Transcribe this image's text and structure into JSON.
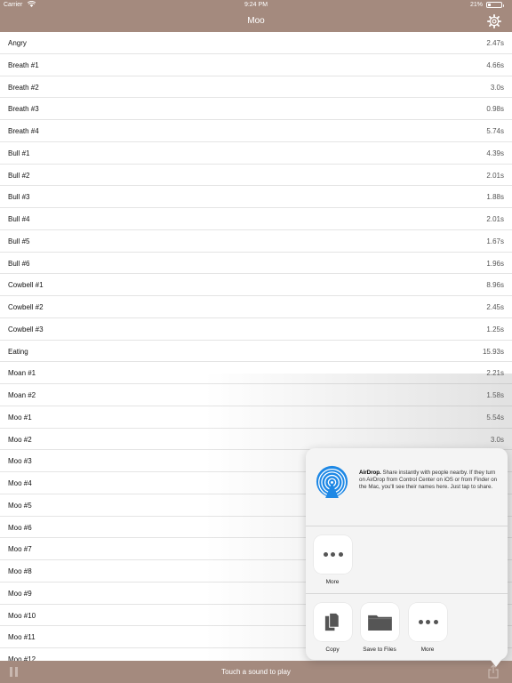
{
  "status_bar": {
    "carrier": "Carrier",
    "time": "9:24 PM",
    "battery": "21%"
  },
  "nav": {
    "title": "Moo",
    "settings_icon": "gear-icon"
  },
  "sounds": [
    {
      "name": "Angry",
      "duration": "2.47s"
    },
    {
      "name": "Breath #1",
      "duration": "4.66s"
    },
    {
      "name": "Breath #2",
      "duration": "3.0s"
    },
    {
      "name": "Breath #3",
      "duration": "0.98s"
    },
    {
      "name": "Breath #4",
      "duration": "5.74s"
    },
    {
      "name": "Bull #1",
      "duration": "4.39s"
    },
    {
      "name": "Bull #2",
      "duration": "2.01s"
    },
    {
      "name": "Bull #3",
      "duration": "1.88s"
    },
    {
      "name": "Bull #4",
      "duration": "2.01s"
    },
    {
      "name": "Bull #5",
      "duration": "1.67s"
    },
    {
      "name": "Bull #6",
      "duration": "1.96s"
    },
    {
      "name": "Cowbell #1",
      "duration": "8.96s"
    },
    {
      "name": "Cowbell #2",
      "duration": "2.45s"
    },
    {
      "name": "Cowbell #3",
      "duration": "1.25s"
    },
    {
      "name": "Eating",
      "duration": "15.93s"
    },
    {
      "name": "Moan #1",
      "duration": "2.21s"
    },
    {
      "name": "Moan #2",
      "duration": "1.58s"
    },
    {
      "name": "Moo #1",
      "duration": "5.54s"
    },
    {
      "name": "Moo #2",
      "duration": "3.0s"
    },
    {
      "name": "Moo #3",
      "duration": ""
    },
    {
      "name": "Moo #4",
      "duration": ""
    },
    {
      "name": "Moo #5",
      "duration": ""
    },
    {
      "name": "Moo #6",
      "duration": ""
    },
    {
      "name": "Moo #7",
      "duration": ""
    },
    {
      "name": "Moo #8",
      "duration": ""
    },
    {
      "name": "Moo #9",
      "duration": ""
    },
    {
      "name": "Moo #10",
      "duration": ""
    },
    {
      "name": "Moo #11",
      "duration": ""
    },
    {
      "name": "Moo #12",
      "duration": ""
    }
  ],
  "toolbar": {
    "hint": "Touch a sound to play",
    "pause_icon": "pause-icon",
    "share_icon": "share-icon"
  },
  "share_sheet": {
    "airdrop_title": "AirDrop.",
    "airdrop_text": "Share instantly with people nearby. If they turn on AirDrop from Control Center on iOS or from Finder on the Mac, you'll see their names here. Just tap to share.",
    "people_more_label": "More",
    "actions": [
      {
        "label": "Copy",
        "icon": "copy-icon"
      },
      {
        "label": "Save to Files",
        "icon": "folder-icon"
      },
      {
        "label": "More",
        "icon": "more-icon"
      }
    ]
  },
  "colors": {
    "bar": "#a48a7e",
    "airdrop": "#1e88e5"
  }
}
